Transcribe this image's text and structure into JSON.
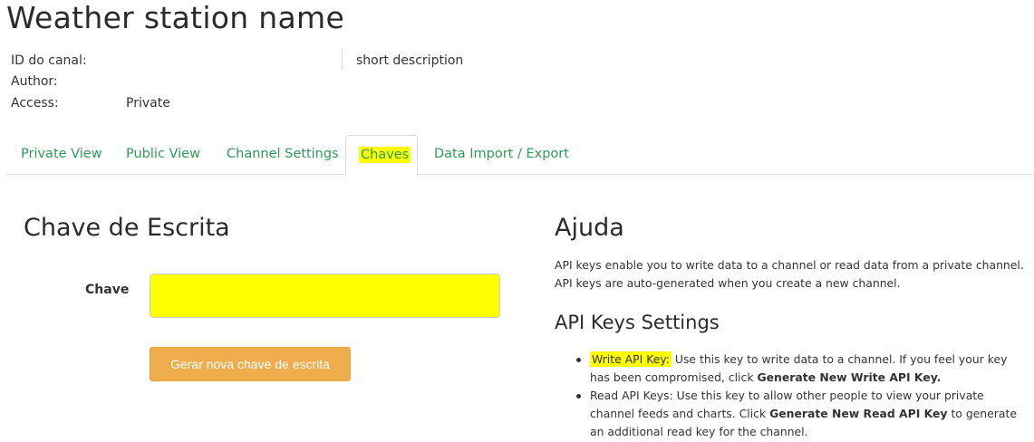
{
  "channel": {
    "title": "Weather station name",
    "id_label": "ID do canal:",
    "id_value": "",
    "author_label": "Author:",
    "author_value": "",
    "access_label": "Access:",
    "access_value": "Private",
    "description": "short description"
  },
  "tabs": [
    {
      "label": "Private View"
    },
    {
      "label": "Public View"
    },
    {
      "label": "Channel Settings"
    },
    {
      "label": "Chaves",
      "active": true
    },
    {
      "label": "Data Import / Export"
    }
  ],
  "write_key": {
    "heading": "Chave de Escrita",
    "field_label": "Chave",
    "field_value": "",
    "button_label": "Gerar nova chave de escrita"
  },
  "help": {
    "heading": "Ajuda",
    "intro": "API keys enable you to write data to a channel or read data from a private channel. API keys are auto-generated when you create a new channel.",
    "settings_heading": "API Keys Settings",
    "items": [
      {
        "term": "Write API Key:",
        "text": " Use this key to write data to a channel. If you feel your key has been compromised, click ",
        "bold": "Generate New Write API Key.",
        "after": ""
      },
      {
        "term": "Read API Keys:",
        "text": " Use this key to allow other people to view your private channel feeds and charts. Click ",
        "bold": "Generate New Read API Key",
        "after": " to generate an additional read key for the channel."
      }
    ]
  },
  "colors": {
    "tab_text": "#2e9a55",
    "highlight": "#ffff00",
    "button": "#f0ad4e"
  }
}
